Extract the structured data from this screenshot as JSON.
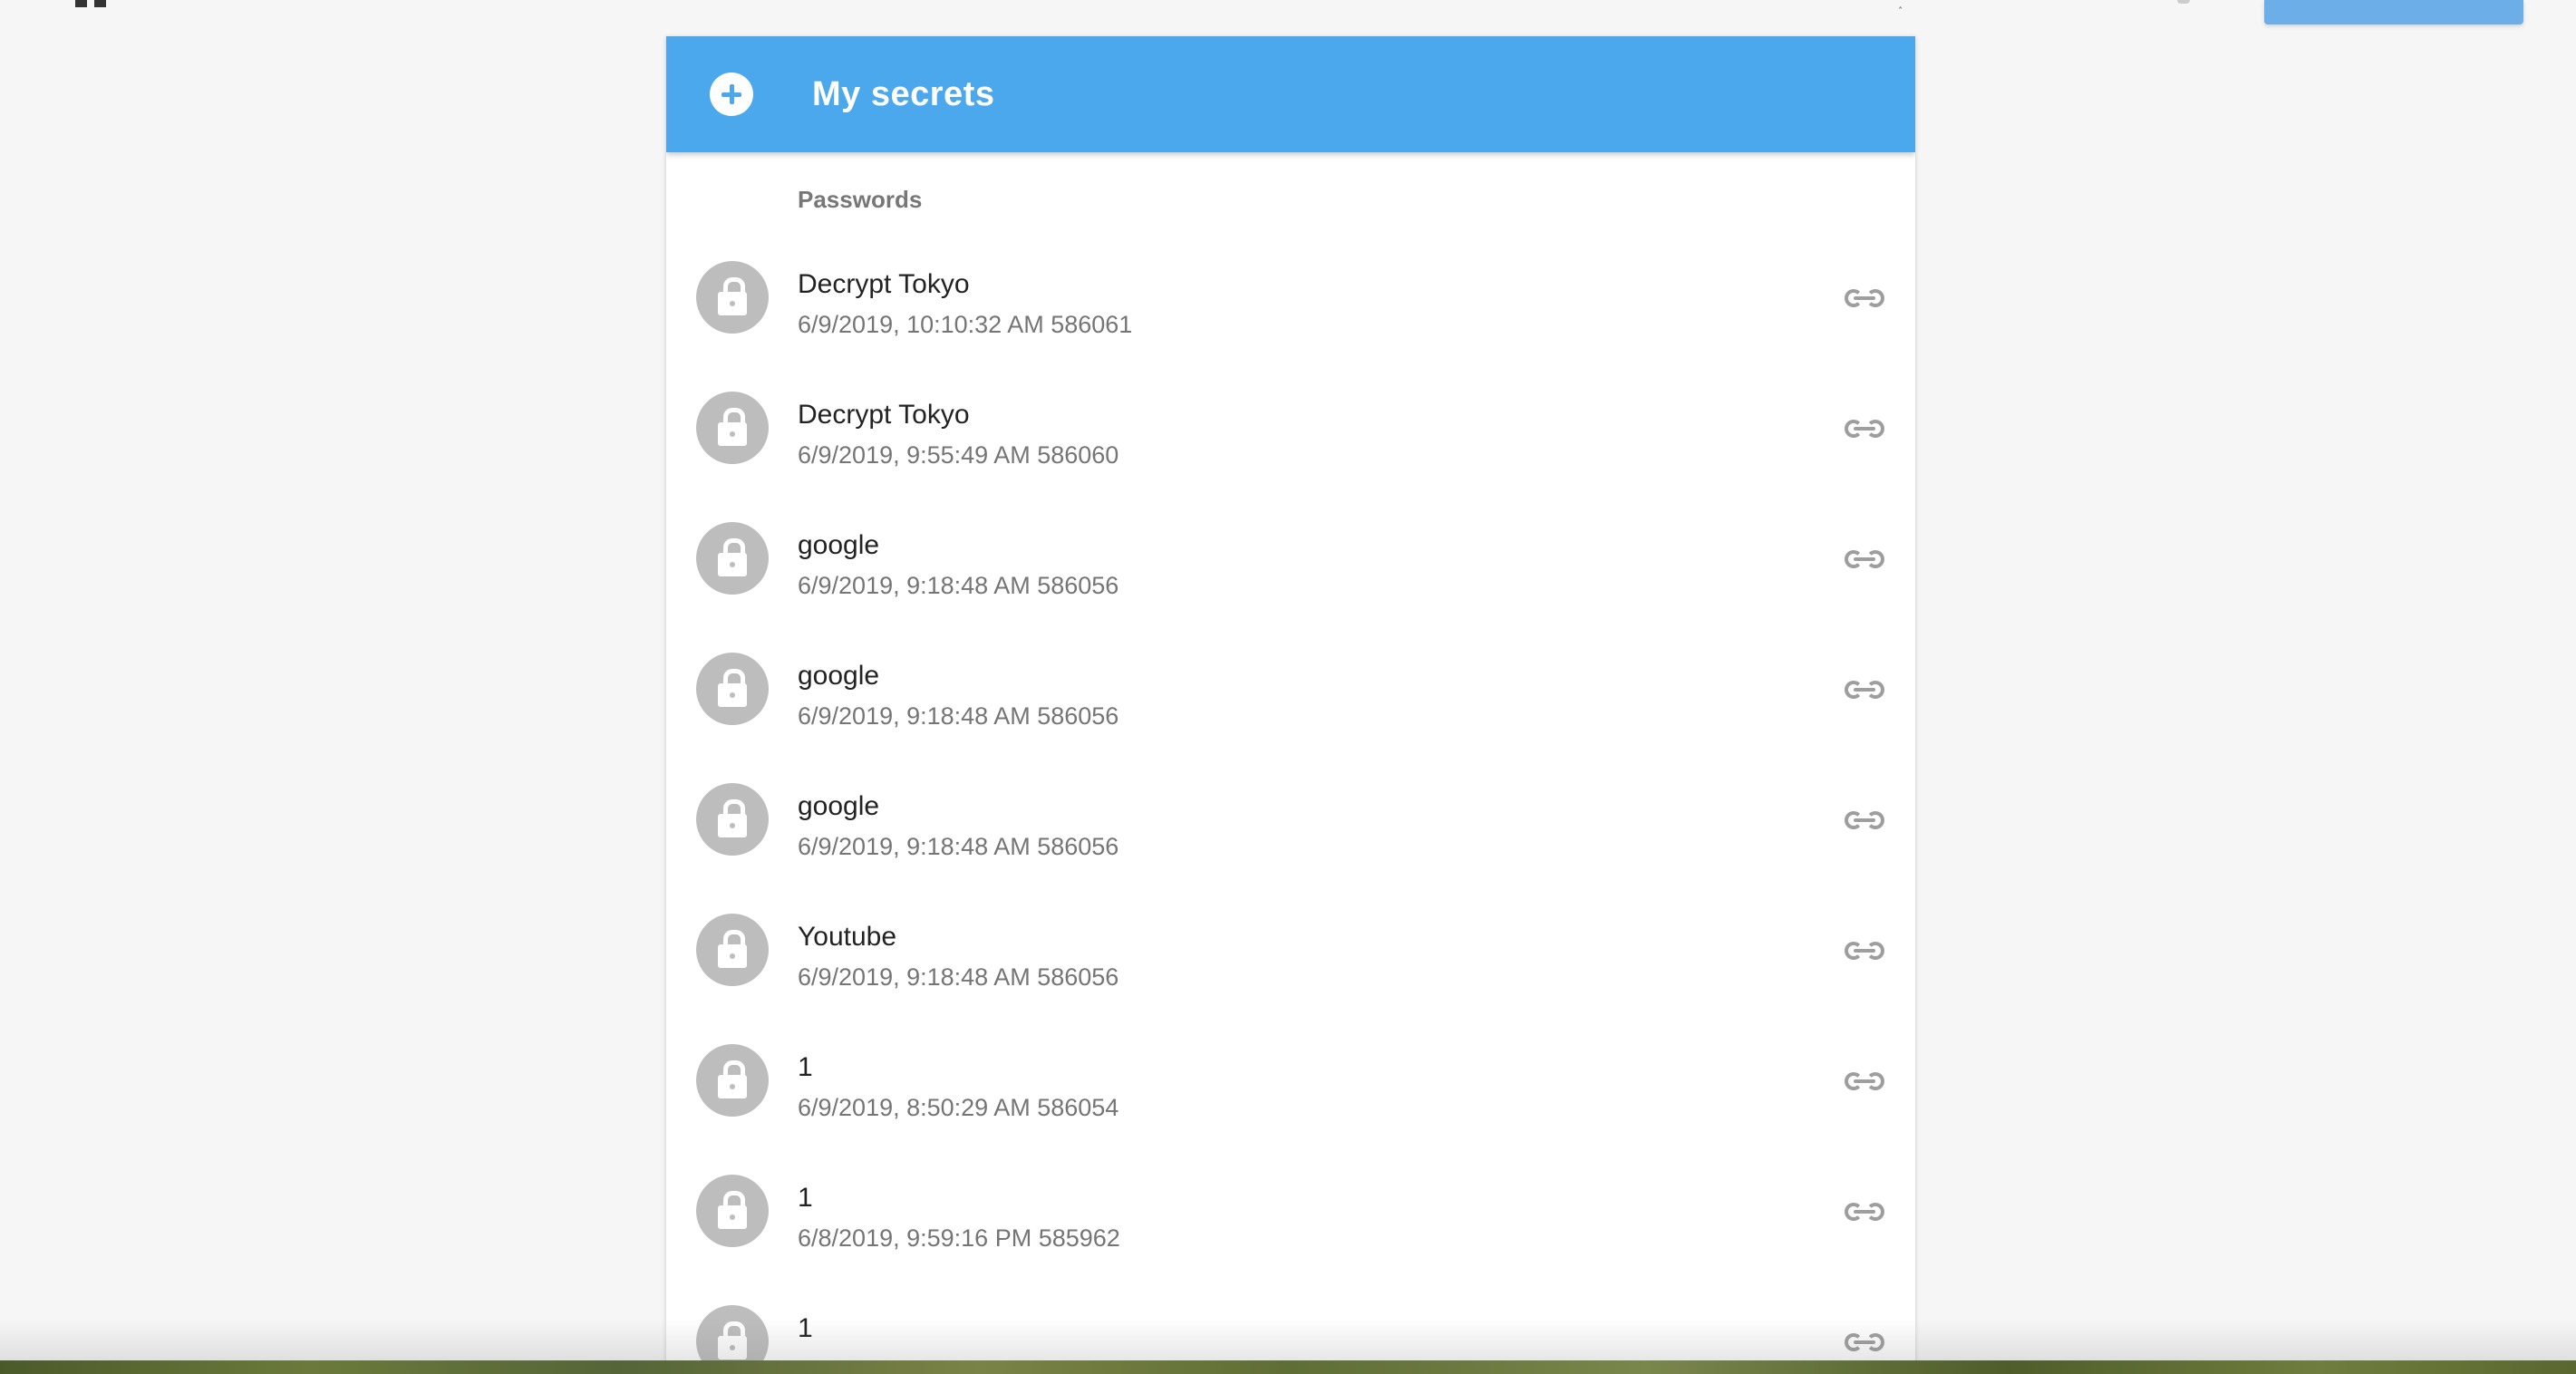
{
  "header": {
    "title": "My secrets",
    "add_icon": "plus-circle-icon",
    "color": "#4ba8ed"
  },
  "section": {
    "label": "Passwords"
  },
  "items": [
    {
      "title": "Decrypt Tokyo",
      "subtitle": "6/9/2019, 10:10:32 AM 586061",
      "icon": "lock-icon",
      "action_icon": "link-icon"
    },
    {
      "title": "Decrypt Tokyo",
      "subtitle": "6/9/2019, 9:55:49 AM 586060",
      "icon": "lock-icon",
      "action_icon": "link-icon"
    },
    {
      "title": "google",
      "subtitle": "6/9/2019, 9:18:48 AM 586056",
      "icon": "lock-icon",
      "action_icon": "link-icon"
    },
    {
      "title": "google",
      "subtitle": "6/9/2019, 9:18:48 AM 586056",
      "icon": "lock-icon",
      "action_icon": "link-icon"
    },
    {
      "title": "google",
      "subtitle": "6/9/2019, 9:18:48 AM 586056",
      "icon": "lock-icon",
      "action_icon": "link-icon"
    },
    {
      "title": "Youtube",
      "subtitle": "6/9/2019, 9:18:48 AM 586056",
      "icon": "lock-icon",
      "action_icon": "link-icon"
    },
    {
      "title": "1",
      "subtitle": "6/9/2019, 8:50:29 AM 586054",
      "icon": "lock-icon",
      "action_icon": "link-icon"
    },
    {
      "title": "1",
      "subtitle": "6/8/2019, 9:59:16 PM 585962",
      "icon": "lock-icon",
      "action_icon": "link-icon"
    },
    {
      "title": "1",
      "subtitle": "",
      "icon": "lock-icon",
      "action_icon": "link-icon"
    }
  ]
}
